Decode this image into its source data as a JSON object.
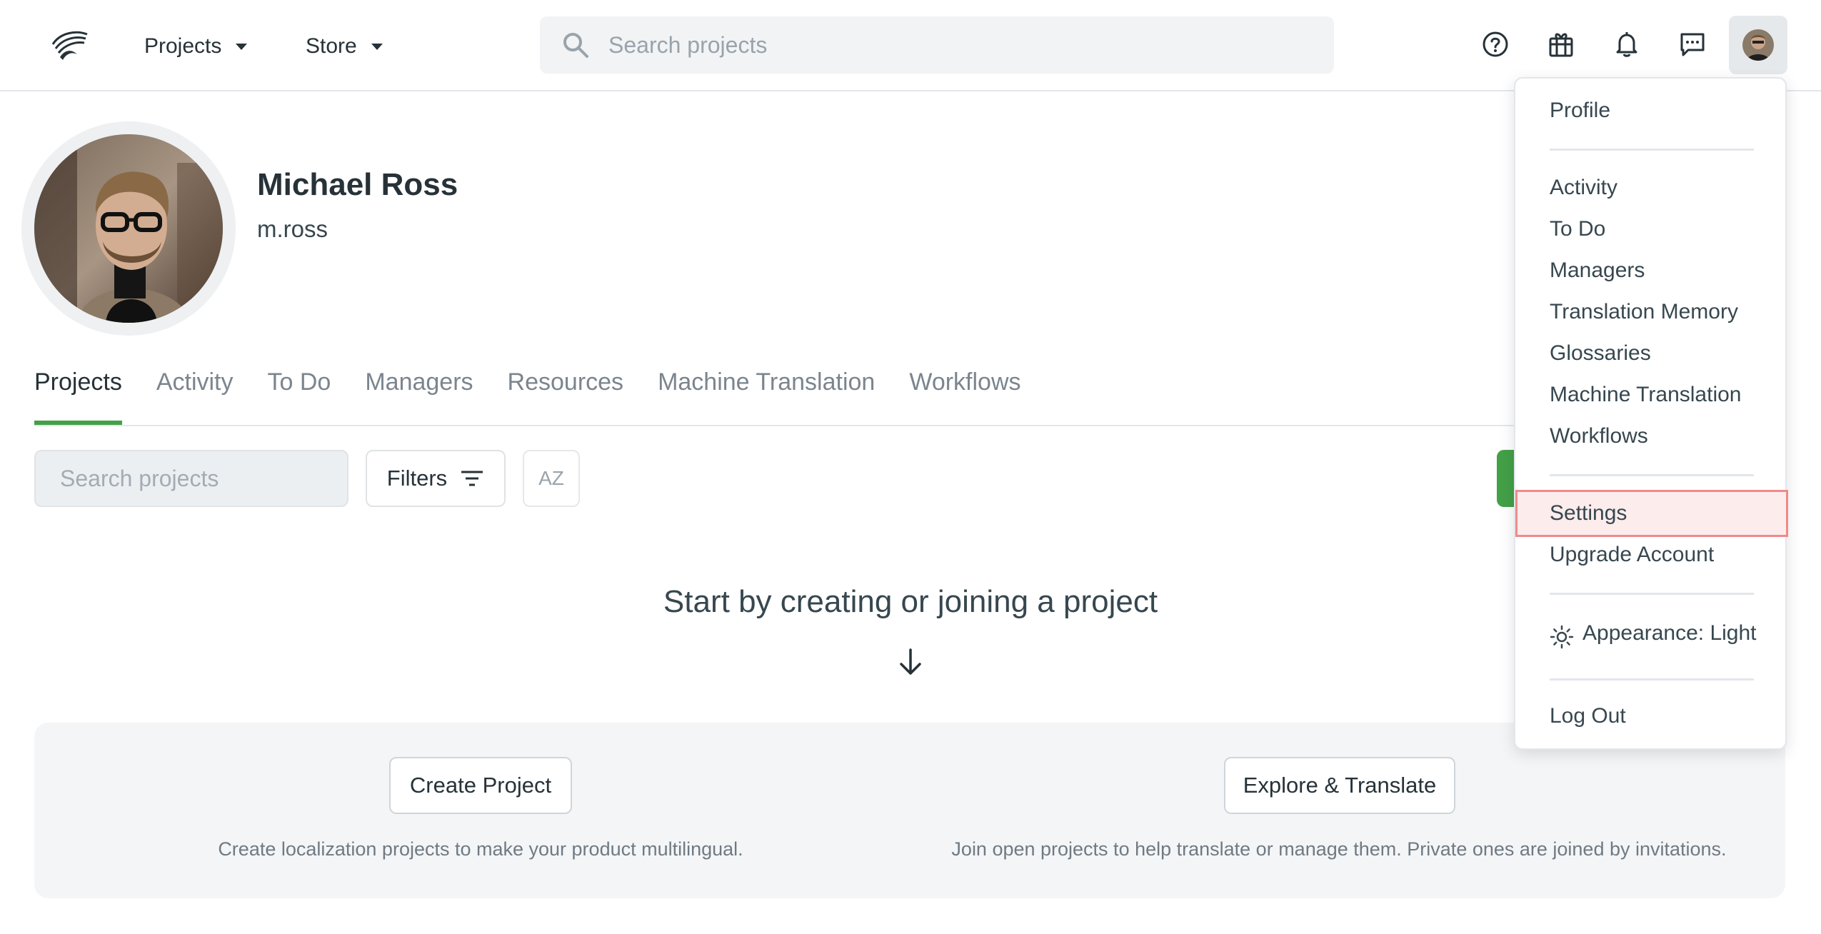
{
  "topbar": {
    "nav": [
      {
        "label": "Projects"
      },
      {
        "label": "Store"
      }
    ],
    "search": {
      "placeholder": "Search projects"
    },
    "icons": [
      "help-icon",
      "store-gift-icon",
      "bell-icon",
      "messages-icon"
    ]
  },
  "profile": {
    "name": "Michael Ross",
    "username": "m.ross"
  },
  "tabs": [
    {
      "label": "Projects",
      "active": true
    },
    {
      "label": "Activity"
    },
    {
      "label": "To Do"
    },
    {
      "label": "Managers"
    },
    {
      "label": "Resources"
    },
    {
      "label": "Machine Translation"
    },
    {
      "label": "Workflows"
    }
  ],
  "filters": {
    "search_placeholder": "Search projects",
    "filters_label": "Filters",
    "sort_label": "AZ"
  },
  "empty_state": {
    "title": "Start by creating or joining a project",
    "create": {
      "button": "Create Project",
      "description": "Create localization projects to make your product multilingual."
    },
    "explore": {
      "button": "Explore & Translate",
      "description": "Join open projects to help translate or manage them. Private ones are joined by invitations."
    }
  },
  "user_menu": {
    "profile": "Profile",
    "items": [
      "Activity",
      "To Do",
      "Managers",
      "Translation Memory",
      "Glossaries",
      "Machine Translation",
      "Workflows"
    ],
    "settings": "Settings",
    "upgrade": "Upgrade Account",
    "appearance": "Appearance: Light",
    "logout": "Log Out"
  },
  "colors": {
    "accent_green": "#43a047",
    "highlight_border": "#f08a8a",
    "highlight_fill": "#fdecec"
  }
}
